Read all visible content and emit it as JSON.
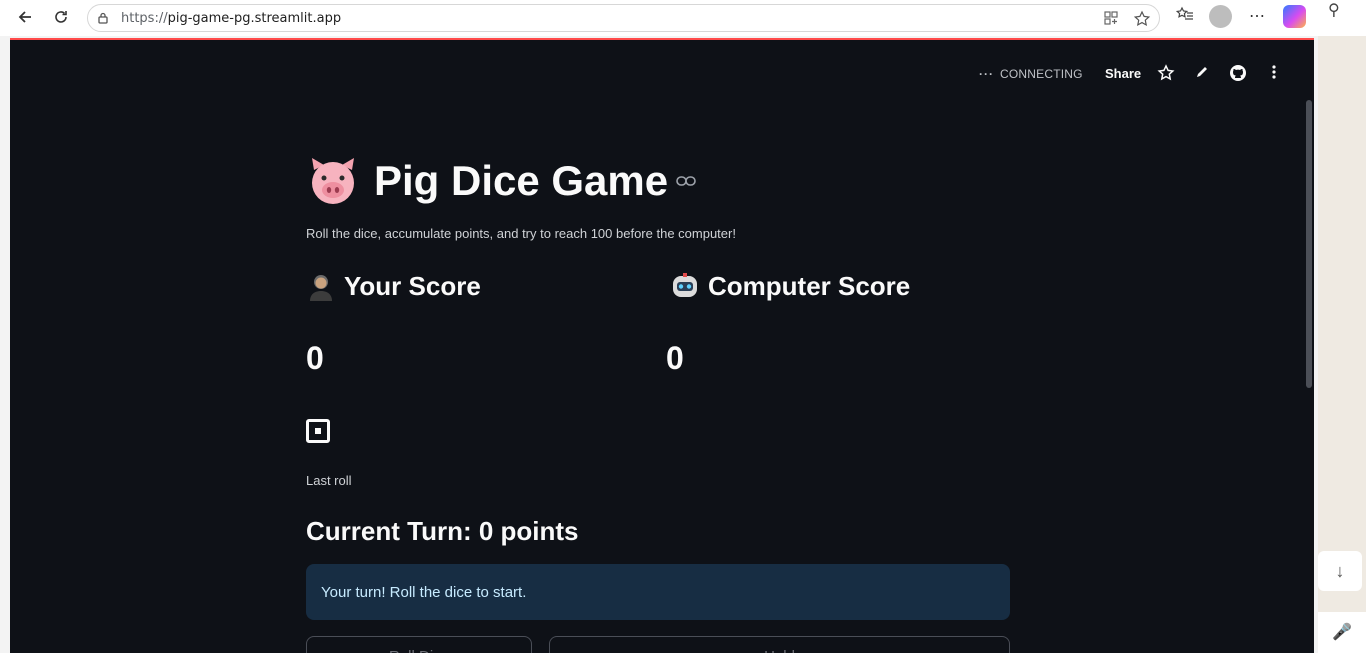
{
  "browser": {
    "url_scheme": "https://",
    "url_host": "pig-game-pg.streamlit.app"
  },
  "app": {
    "status_text": "CONNECTING",
    "status_dots": "···",
    "share_label": "Share"
  },
  "page": {
    "title": "Pig Dice Game",
    "subtitle": "Roll the dice, accumulate points, and try to reach 100 before the computer!",
    "player_heading": "Your Score",
    "computer_heading": "Computer Score",
    "player_score": "0",
    "computer_score": "0",
    "last_roll_label": "Last roll",
    "current_turn": "Current Turn: 0 points",
    "info_message": "Your turn! Roll the dice to start.",
    "roll_button": "Roll Dice",
    "hold_button": "Hold"
  },
  "colors": {
    "app_bg": "#0e1117",
    "info_bg": "#172d43",
    "accent": "#ff4b4b"
  }
}
